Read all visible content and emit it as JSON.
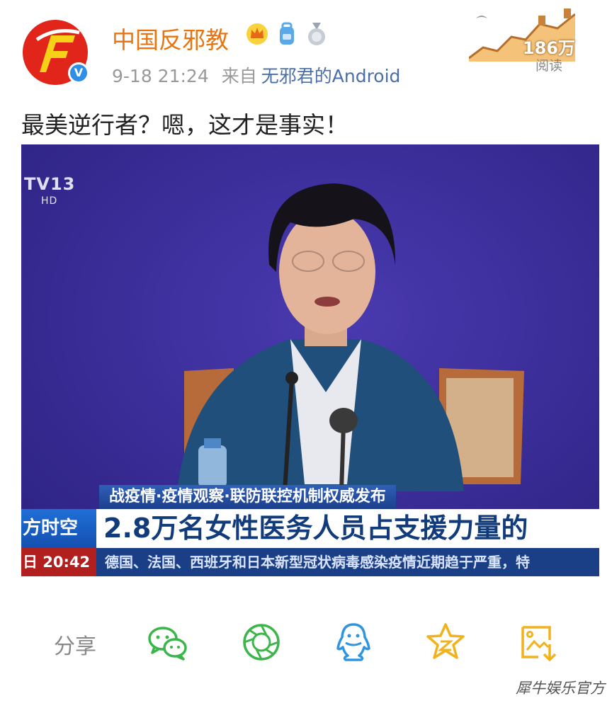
{
  "post": {
    "username": "中国反邪教",
    "timestamp": "9-18 21:24",
    "source_prefix": "来自",
    "source": "无邪君的Android",
    "text": "最美逆行者？嗯，这才是事实！",
    "read_count": "186万",
    "read_label": "阅读",
    "verified_badge": "V",
    "badges": [
      "crown-icon",
      "backpack-icon",
      "medal-icon"
    ]
  },
  "video": {
    "channel": "TV13",
    "channel_hd": "HD",
    "banner_top": "战疫情·疫情观察·联防联控机制权威发布",
    "banner_tag": "方时空",
    "headline": "2.8万名女性医务人员占支援力量的",
    "clock": "日 20:42",
    "ticker": "德国、法国、西班牙和日本新型冠状病毒感染疫情近期趋于严重，特"
  },
  "share": {
    "label": "分享",
    "targets": [
      "wechat-icon",
      "moments-icon",
      "qq-icon",
      "qzone-icon",
      "save-image-icon"
    ]
  },
  "footer": {
    "watermark": "犀牛娱乐官方"
  },
  "colors": {
    "username": "#e87512",
    "source_link": "#4a6fa8",
    "studio_bg": "#3d2f9e",
    "share_green": "#3cb54a",
    "share_blue": "#2f95e0",
    "share_yellow": "#f1b21c"
  }
}
